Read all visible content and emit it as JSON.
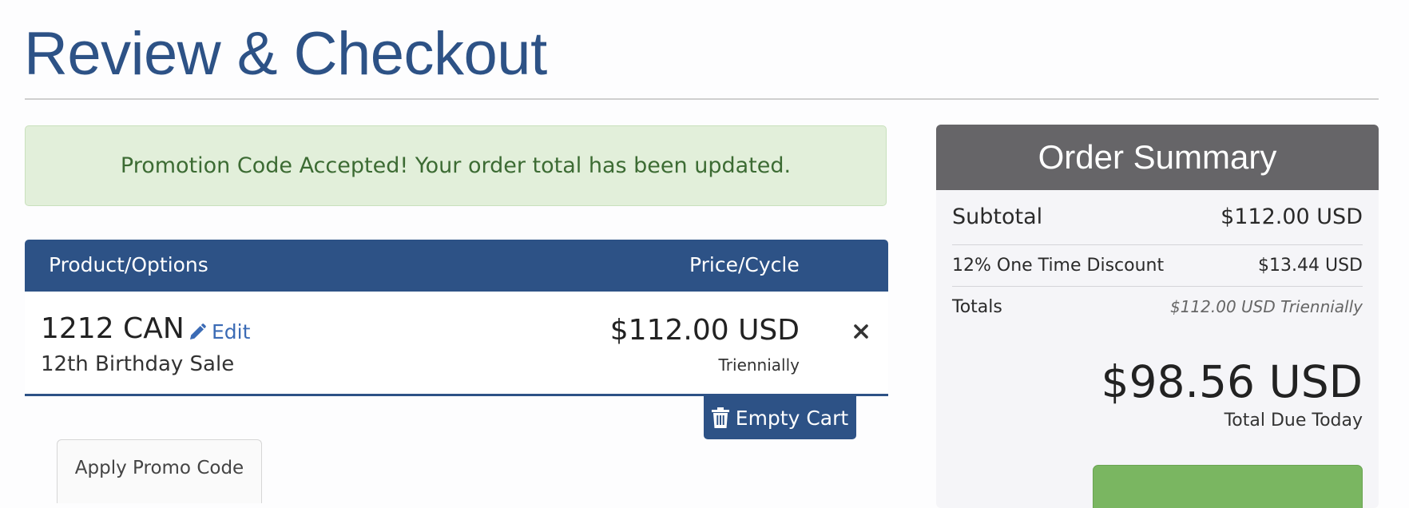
{
  "page": {
    "title": "Review & Checkout"
  },
  "alert": {
    "message": "Promotion Code Accepted! Your order total has been updated."
  },
  "cart": {
    "headers": {
      "product": "Product/Options",
      "price": "Price/Cycle"
    },
    "items": [
      {
        "name": "1212 CAN",
        "edit_label": "Edit",
        "group": "12th Birthday Sale",
        "price": "$112.00 USD",
        "cycle": "Triennially"
      }
    ],
    "empty_cart_label": "Empty Cart",
    "promo_tab_label": "Apply Promo Code"
  },
  "summary": {
    "title": "Order Summary",
    "subtotal_label": "Subtotal",
    "subtotal_value": "$112.00 USD",
    "discount_label": "12% One Time Discount",
    "discount_value": "$13.44 USD",
    "totals_label": "Totals",
    "totals_value": "$112.00 USD Triennially",
    "total_due": "$98.56 USD",
    "total_due_label": "Total Due Today"
  },
  "colors": {
    "brand_blue": "#2d5286",
    "success_bg": "#e2efda",
    "summary_header": "#666568",
    "checkout_green": "#7ab661"
  },
  "icons": [
    "pencil-icon",
    "close-icon",
    "trash-icon"
  ]
}
